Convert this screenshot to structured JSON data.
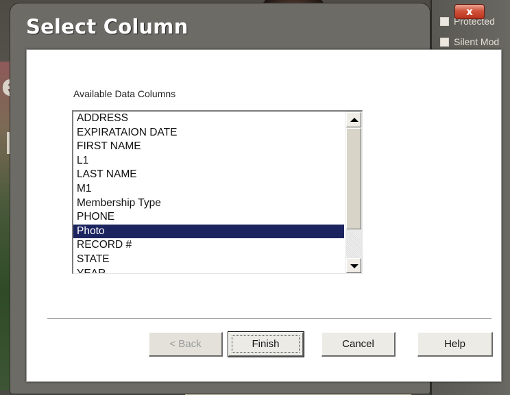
{
  "window": {
    "title": "Select Column",
    "close_label": "x"
  },
  "background": {
    "right_panel": {
      "items": [
        {
          "label": "Protected",
          "checked": false
        },
        {
          "label": "Silent Mod",
          "checked": false
        }
      ]
    }
  },
  "dialog": {
    "columns_label": "Available Data Columns",
    "columns": [
      "ADDRESS",
      "EXPIRATAION DATE",
      "FIRST NAME",
      "L1",
      "LAST NAME",
      "M1",
      "Membership Type",
      "PHONE",
      "Photo",
      "RECORD #",
      "STATE",
      "YEAR"
    ],
    "selected_column": "Photo",
    "buttons": {
      "back": "< Back",
      "finish": "Finish",
      "cancel": "Cancel",
      "help": "Help"
    }
  },
  "colors": {
    "selection": "#1c2460",
    "dialog_bg": "#ffffff",
    "close_button": "#c9452f"
  }
}
